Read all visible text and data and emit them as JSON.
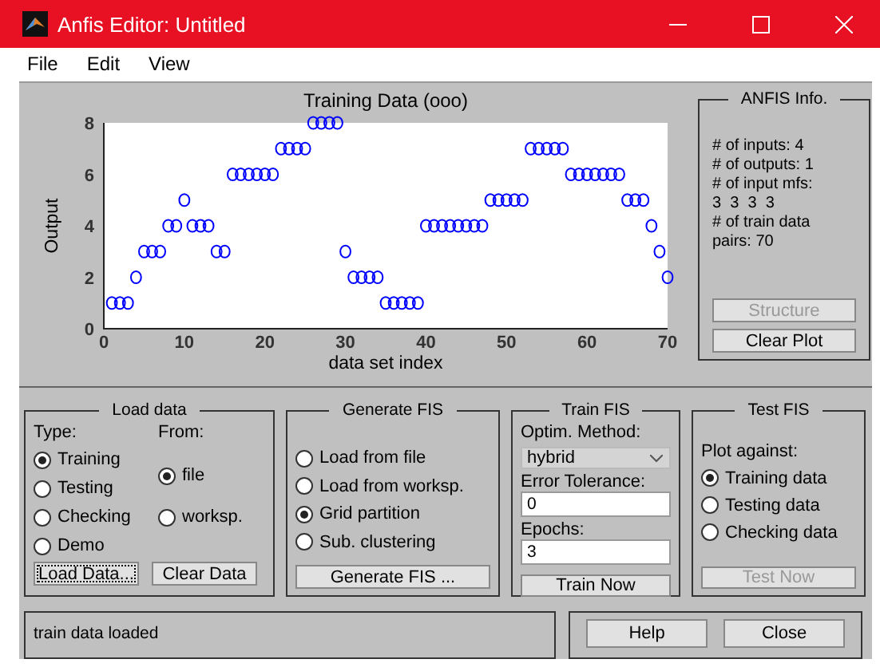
{
  "window": {
    "title": "Anfis Editor: Untitled"
  },
  "menu": [
    "File",
    "Edit",
    "View"
  ],
  "plot": {
    "chart_data": {
      "type": "scatter",
      "title": "Training Data (ooo)",
      "xlabel": "data set index",
      "ylabel": "Output",
      "xlim": [
        0,
        70
      ],
      "ylim": [
        0,
        8
      ],
      "xticks": [
        0,
        10,
        20,
        30,
        40,
        50,
        60,
        70
      ],
      "yticks": [
        0,
        2,
        4,
        6,
        8
      ],
      "x": [
        1,
        2,
        3,
        4,
        5,
        6,
        7,
        8,
        9,
        10,
        11,
        12,
        13,
        14,
        15,
        16,
        17,
        18,
        19,
        20,
        21,
        22,
        23,
        24,
        25,
        26,
        27,
        28,
        29,
        30,
        31,
        32,
        33,
        34,
        35,
        36,
        37,
        38,
        39,
        40,
        41,
        42,
        43,
        44,
        45,
        46,
        47,
        48,
        49,
        50,
        51,
        52,
        53,
        54,
        55,
        56,
        57,
        58,
        59,
        60,
        61,
        62,
        63,
        64,
        65,
        66,
        67,
        68,
        69,
        70
      ],
      "series": [
        {
          "color": "#0000ff",
          "values": [
            1,
            1,
            1,
            2,
            3,
            3,
            3,
            4,
            4,
            5,
            4,
            4,
            4,
            3,
            3,
            6,
            6,
            6,
            6,
            6,
            6,
            7,
            7,
            7,
            7,
            8,
            8,
            8,
            8,
            3,
            2,
            2,
            2,
            2,
            1,
            1,
            1,
            1,
            1,
            4,
            4,
            4,
            4,
            4,
            4,
            4,
            4,
            5,
            5,
            5,
            5,
            5,
            7,
            7,
            7,
            7,
            7,
            6,
            6,
            6,
            6,
            6,
            6,
            6,
            5,
            5,
            5,
            4,
            3,
            2
          ]
        }
      ]
    }
  },
  "anfis_info": {
    "title": "ANFIS Info.",
    "lines": [
      "# of inputs: 4",
      "# of outputs: 1",
      "# of input mfs:",
      "3  3  3  3",
      "# of train data",
      "pairs: 70"
    ],
    "buttons": [
      {
        "label": "Structure",
        "disabled": true,
        "focused": false
      },
      {
        "label": "Clear Plot",
        "disabled": false,
        "focused": false
      }
    ]
  },
  "load_data": {
    "title": "Load data",
    "type_label": "Type:",
    "from_label": "From:",
    "type_options": [
      {
        "label": "Training",
        "selected": true
      },
      {
        "label": "Testing",
        "selected": false
      },
      {
        "label": "Checking",
        "selected": false
      },
      {
        "label": "Demo",
        "selected": false
      }
    ],
    "from_options": [
      {
        "label": "file",
        "selected": true
      },
      {
        "label": "worksp.",
        "selected": false
      }
    ],
    "buttons": [
      {
        "label": "Load Data...",
        "disabled": false,
        "focused": true
      },
      {
        "label": "Clear Data",
        "disabled": false,
        "focused": false
      }
    ]
  },
  "generate_fis": {
    "title": "Generate FIS",
    "options": [
      {
        "label": "Load from file",
        "selected": false
      },
      {
        "label": "Load from worksp.",
        "selected": false
      },
      {
        "label": "Grid partition",
        "selected": true
      },
      {
        "label": "Sub. clustering",
        "selected": false
      }
    ],
    "button": {
      "label": "Generate FIS ...",
      "disabled": false,
      "focused": false
    }
  },
  "train_fis": {
    "title": "Train FIS",
    "method_label": "Optim. Method:",
    "method": "hybrid",
    "error_label": "Error Tolerance:",
    "error_value": "0",
    "epochs_label": "Epochs:",
    "epochs_value": "3",
    "button": {
      "label": "Train Now",
      "disabled": false,
      "focused": false
    }
  },
  "test_fis": {
    "title": "Test FIS",
    "plot_label": "Plot against:",
    "options": [
      {
        "label": "Training data",
        "selected": true
      },
      {
        "label": "Testing data",
        "selected": false
      },
      {
        "label": "Checking data",
        "selected": false
      }
    ],
    "button": {
      "label": "Test Now",
      "disabled": true,
      "focused": false
    }
  },
  "status": "train data loaded",
  "bottom_buttons": [
    {
      "label": "Help",
      "disabled": false,
      "focused": false
    },
    {
      "label": "Close",
      "disabled": false,
      "focused": false
    }
  ]
}
